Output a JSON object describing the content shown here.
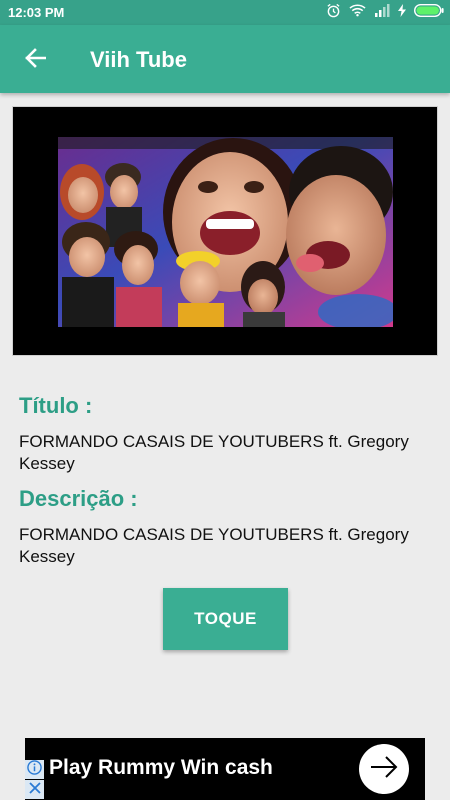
{
  "status_bar": {
    "time": "12:03 PM",
    "icons": [
      "alarm-icon",
      "wifi-icon",
      "signal-icon",
      "charging-icon",
      "battery-icon"
    ]
  },
  "app_bar": {
    "title": "Viih Tube",
    "back_icon": "arrow-left-icon"
  },
  "video": {
    "thumbnail": "video-thumbnail"
  },
  "details": {
    "title_label": "Título :",
    "title_value": "FORMANDO CASAIS DE YOUTUBERS ft. Gregory Kessey",
    "description_label": "Descrição :",
    "description_value": "FORMANDO CASAIS DE YOUTUBERS ft. Gregory Kessey"
  },
  "action": {
    "button_label": "TOQUE"
  },
  "ad": {
    "text": "Play Rummy Win cash",
    "icons": [
      "info-icon",
      "close-icon",
      "arrow-right-icon"
    ]
  },
  "colors": {
    "primary": "#3aae93",
    "primary_dark": "#37a28a",
    "label": "#2d9e86",
    "background": "#ececec"
  }
}
